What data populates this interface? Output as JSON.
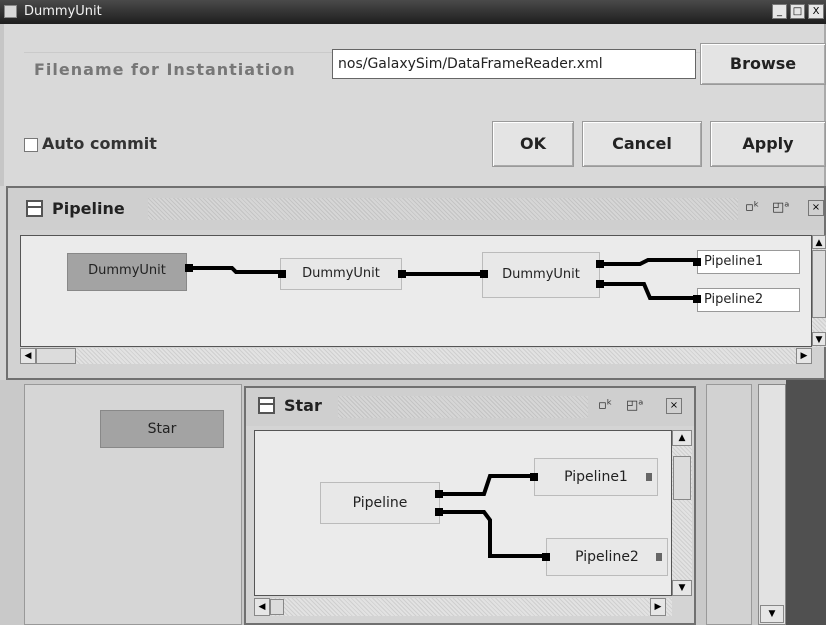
{
  "window": {
    "title": "DummyUnit",
    "buttons": {
      "minimize": "_",
      "maximize": "□",
      "close": "X"
    }
  },
  "dialog": {
    "filename_label": "Filename for Instantiation",
    "filename_value": "nos/GalaxySim/DataFrameReader.xml",
    "browse_label": "Browse",
    "auto_commit_label": "Auto commit",
    "auto_commit_checked": false,
    "ok_label": "OK",
    "cancel_label": "Cancel",
    "apply_label": "Apply"
  },
  "pipeline_frame": {
    "title": "Pipeline",
    "nodes": [
      "DummyUnit",
      "DummyUnit",
      "DummyUnit"
    ],
    "outputs": [
      "Pipeline1",
      "Pipeline2"
    ],
    "selected_node": "DummyUnit"
  },
  "palette": {
    "star_label": "Star"
  },
  "star_frame": {
    "title": "Star",
    "input_node": "Pipeline",
    "outputs": [
      "Pipeline1",
      "Pipeline2"
    ]
  },
  "icons": {
    "frame": "window-icon",
    "restore": "restore-icon",
    "maximize": "maximize-icon",
    "close": "close-icon"
  },
  "colors": {
    "titlebar": "#1e1e1e",
    "selected_node": "#a3a3a3",
    "wire": "#000000"
  }
}
